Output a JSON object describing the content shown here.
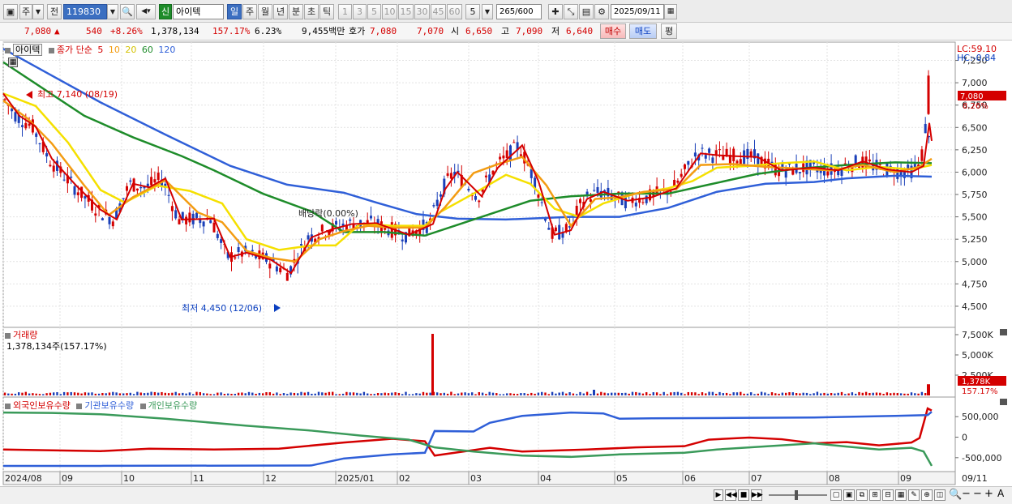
{
  "toolbar": {
    "market": "주",
    "prev": "전",
    "code": "119830",
    "badge_new": "신",
    "name": "아이텍",
    "periods": [
      "일",
      "주",
      "월",
      "년",
      "분",
      "초",
      "틱"
    ],
    "selected_period": "일",
    "intervals": [
      "1",
      "3",
      "5",
      "10",
      "15",
      "30",
      "45",
      "60"
    ],
    "interval_value": "5",
    "count": "265",
    "count_total": "/600",
    "date": "2025/09/11"
  },
  "quote": {
    "price": "7,080",
    "arrow": "▲",
    "change": "540",
    "change_pct": "+8.26%",
    "volume": "1,378,134",
    "volume_ratio": "157.17%",
    "turnover": "6.23%",
    "amount": "9,455백만",
    "bid_label": "호가",
    "ask": "7,080",
    "bid": "7,070",
    "open_label": "시",
    "open": "6,650",
    "high_label": "고",
    "high": "7,090",
    "low_label": "저",
    "low": "6,640",
    "buy_button": "매수",
    "sell_button": "매도",
    "eval_button": "평"
  },
  "price_panel": {
    "stock_label": "아이텍",
    "ma_title": "종가 단순",
    "ma_periods": [
      "5",
      "10",
      "20",
      "60",
      "120"
    ],
    "ma_colors": [
      "#d40000",
      "#f39c12",
      "#f5e000",
      "#1e8c2a",
      "#2f5fd8"
    ],
    "lc": "LC:59.10",
    "hc": "HC:-0.84",
    "last_price_tag": "7,080",
    "last_pct_tag": "8.26%",
    "high_note": "최고 7,140 (08/19)",
    "low_note": "최저 4,450 (12/06)",
    "dividend_note": "배당락(0.00%)",
    "y_ticks": [
      "7,250",
      "7,000",
      "6,750",
      "6,500",
      "6,250",
      "6,000",
      "5,750",
      "5,500",
      "5,250",
      "5,000",
      "4,750",
      "4,500"
    ]
  },
  "volume_panel": {
    "title": "거래량",
    "value": "1,378,134주(157.17%)",
    "y_ticks": [
      "7,500K",
      "5,000K",
      "2,500K"
    ],
    "last_tag": "1,378K",
    "last_pct": "157.17%"
  },
  "holding_panel": {
    "series": [
      {
        "name": "외국인보유수량",
        "color": "#d40000"
      },
      {
        "name": "기관보유수량",
        "color": "#2f5fd8"
      },
      {
        "name": "개인보유수량",
        "color": "#3a9a5a"
      }
    ],
    "y_ticks": [
      "500,000",
      "0",
      "-500,000"
    ]
  },
  "x_axis": {
    "labels": [
      "2024/08",
      "09",
      "10",
      "11",
      "12",
      "2025/01",
      "02",
      "03",
      "04",
      "05",
      "06",
      "07",
      "08",
      "09"
    ],
    "end_label": "09/11"
  },
  "chart_data": {
    "type": "line",
    "title": "아이텍",
    "ylim": [
      4300,
      7400
    ],
    "ma_lines": [
      {
        "name": "120",
        "points": [
          [
            0,
            7380
          ],
          [
            60,
            7080
          ],
          [
            120,
            6780
          ],
          [
            200,
            6420
          ],
          [
            280,
            6070
          ],
          [
            350,
            5860
          ],
          [
            420,
            5770
          ],
          [
            460,
            5660
          ],
          [
            510,
            5530
          ],
          [
            560,
            5480
          ],
          [
            620,
            5470
          ],
          [
            700,
            5500
          ],
          [
            760,
            5500
          ],
          [
            820,
            5600
          ],
          [
            880,
            5780
          ],
          [
            940,
            5870
          ],
          [
            1000,
            5890
          ],
          [
            1040,
            5930
          ],
          [
            1100,
            5960
          ],
          [
            1145,
            5950
          ]
        ]
      },
      {
        "name": "60",
        "points": [
          [
            0,
            7230
          ],
          [
            50,
            6930
          ],
          [
            100,
            6630
          ],
          [
            160,
            6390
          ],
          [
            220,
            6180
          ],
          [
            260,
            6020
          ],
          [
            320,
            5760
          ],
          [
            380,
            5560
          ],
          [
            420,
            5330
          ],
          [
            470,
            5330
          ],
          [
            520,
            5290
          ],
          [
            560,
            5410
          ],
          [
            600,
            5530
          ],
          [
            650,
            5680
          ],
          [
            700,
            5730
          ],
          [
            760,
            5760
          ],
          [
            820,
            5760
          ],
          [
            870,
            5860
          ],
          [
            930,
            5980
          ],
          [
            980,
            6040
          ],
          [
            1040,
            6080
          ],
          [
            1100,
            6110
          ],
          [
            1145,
            6100
          ]
        ]
      },
      {
        "name": "20",
        "points": [
          [
            0,
            6880
          ],
          [
            40,
            6740
          ],
          [
            80,
            6330
          ],
          [
            120,
            5800
          ],
          [
            150,
            5660
          ],
          [
            190,
            5850
          ],
          [
            230,
            5790
          ],
          [
            270,
            5650
          ],
          [
            300,
            5250
          ],
          [
            340,
            5130
          ],
          [
            380,
            5180
          ],
          [
            410,
            5180
          ],
          [
            440,
            5420
          ],
          [
            480,
            5400
          ],
          [
            520,
            5400
          ],
          [
            540,
            5560
          ],
          [
            580,
            5760
          ],
          [
            620,
            5970
          ],
          [
            650,
            5870
          ],
          [
            680,
            5590
          ],
          [
            710,
            5500
          ],
          [
            740,
            5650
          ],
          [
            780,
            5760
          ],
          [
            820,
            5820
          ],
          [
            850,
            5900
          ],
          [
            880,
            6050
          ],
          [
            920,
            6070
          ],
          [
            960,
            6100
          ],
          [
            1000,
            6120
          ],
          [
            1040,
            6020
          ],
          [
            1080,
            6060
          ],
          [
            1120,
            6030
          ],
          [
            1145,
            6080
          ]
        ]
      },
      {
        "name": "10",
        "points": [
          [
            0,
            6800
          ],
          [
            30,
            6600
          ],
          [
            60,
            6320
          ],
          [
            100,
            5850
          ],
          [
            130,
            5520
          ],
          [
            160,
            5720
          ],
          [
            200,
            5910
          ],
          [
            240,
            5550
          ],
          [
            270,
            5440
          ],
          [
            300,
            5120
          ],
          [
            330,
            5040
          ],
          [
            360,
            5000
          ],
          [
            390,
            5250
          ],
          [
            420,
            5340
          ],
          [
            450,
            5400
          ],
          [
            480,
            5380
          ],
          [
            520,
            5380
          ],
          [
            545,
            5610
          ],
          [
            580,
            5990
          ],
          [
            610,
            6090
          ],
          [
            640,
            6170
          ],
          [
            670,
            5850
          ],
          [
            700,
            5400
          ],
          [
            730,
            5700
          ],
          [
            760,
            5720
          ],
          [
            790,
            5780
          ],
          [
            830,
            5810
          ],
          [
            860,
            6080
          ],
          [
            900,
            6090
          ],
          [
            940,
            6060
          ],
          [
            980,
            6040
          ],
          [
            1020,
            6020
          ],
          [
            1060,
            6080
          ],
          [
            1100,
            6000
          ],
          [
            1130,
            6060
          ],
          [
            1145,
            6150
          ]
        ]
      },
      {
        "name": "5",
        "points": [
          [
            0,
            6880
          ],
          [
            20,
            6630
          ],
          [
            40,
            6510
          ],
          [
            60,
            6150
          ],
          [
            90,
            5850
          ],
          [
            120,
            5580
          ],
          [
            140,
            5470
          ],
          [
            160,
            5870
          ],
          [
            180,
            5830
          ],
          [
            200,
            5930
          ],
          [
            220,
            5470
          ],
          [
            260,
            5480
          ],
          [
            280,
            5050
          ],
          [
            300,
            5100
          ],
          [
            330,
            5020
          ],
          [
            355,
            4870
          ],
          [
            380,
            5270
          ],
          [
            405,
            5360
          ],
          [
            430,
            5420
          ],
          [
            460,
            5430
          ],
          [
            500,
            5300
          ],
          [
            530,
            5420
          ],
          [
            545,
            5810
          ],
          [
            560,
            6000
          ],
          [
            590,
            5730
          ],
          [
            610,
            6050
          ],
          [
            640,
            6300
          ],
          [
            660,
            5900
          ],
          [
            680,
            5300
          ],
          [
            700,
            5350
          ],
          [
            720,
            5700
          ],
          [
            740,
            5780
          ],
          [
            770,
            5680
          ],
          [
            800,
            5720
          ],
          [
            830,
            5820
          ],
          [
            860,
            6210
          ],
          [
            880,
            6190
          ],
          [
            900,
            6180
          ],
          [
            930,
            6170
          ],
          [
            960,
            6020
          ],
          [
            1000,
            6050
          ],
          [
            1030,
            6020
          ],
          [
            1060,
            6120
          ],
          [
            1090,
            6030
          ],
          [
            1120,
            6000
          ],
          [
            1135,
            6070
          ],
          [
            1142,
            6550
          ],
          [
            1145,
            6350
          ]
        ]
      }
    ],
    "volume_spike": {
      "x": 532,
      "value": 7600
    },
    "holding_lines": [
      {
        "name": "외국인보유수량",
        "points": [
          [
            0,
            -300
          ],
          [
            60,
            -320
          ],
          [
            120,
            -340
          ],
          [
            180,
            -280
          ],
          [
            260,
            -300
          ],
          [
            340,
            -280
          ],
          [
            420,
            -130
          ],
          [
            480,
            -40
          ],
          [
            520,
            -100
          ],
          [
            532,
            -450
          ],
          [
            600,
            -260
          ],
          [
            640,
            -350
          ],
          [
            720,
            -300
          ],
          [
            780,
            -250
          ],
          [
            840,
            -220
          ],
          [
            870,
            -60
          ],
          [
            920,
            -10
          ],
          [
            960,
            -50
          ],
          [
            1000,
            -150
          ],
          [
            1040,
            -120
          ],
          [
            1080,
            -200
          ],
          [
            1120,
            -130
          ],
          [
            1130,
            -20
          ],
          [
            1140,
            700
          ],
          [
            1145,
            650
          ]
        ]
      },
      {
        "name": "기관보유수량",
        "points": [
          [
            0,
            -700
          ],
          [
            120,
            -700
          ],
          [
            380,
            -690
          ],
          [
            420,
            -520
          ],
          [
            480,
            -420
          ],
          [
            520,
            -380
          ],
          [
            532,
            150
          ],
          [
            580,
            140
          ],
          [
            600,
            350
          ],
          [
            640,
            520
          ],
          [
            700,
            600
          ],
          [
            740,
            580
          ],
          [
            760,
            450
          ],
          [
            800,
            460
          ],
          [
            900,
            470
          ],
          [
            1000,
            480
          ],
          [
            1100,
            520
          ],
          [
            1140,
            540
          ],
          [
            1145,
            620
          ]
        ]
      },
      {
        "name": "개인보유수량",
        "points": [
          [
            0,
            600
          ],
          [
            60,
            590
          ],
          [
            120,
            560
          ],
          [
            200,
            450
          ],
          [
            300,
            280
          ],
          [
            380,
            160
          ],
          [
            440,
            40
          ],
          [
            500,
            -60
          ],
          [
            532,
            -250
          ],
          [
            580,
            -350
          ],
          [
            640,
            -450
          ],
          [
            700,
            -480
          ],
          [
            760,
            -420
          ],
          [
            840,
            -380
          ],
          [
            880,
            -300
          ],
          [
            960,
            -200
          ],
          [
            1000,
            -150
          ],
          [
            1040,
            -230
          ],
          [
            1080,
            -300
          ],
          [
            1120,
            -260
          ],
          [
            1135,
            -350
          ],
          [
            1145,
            -700
          ]
        ]
      }
    ]
  }
}
